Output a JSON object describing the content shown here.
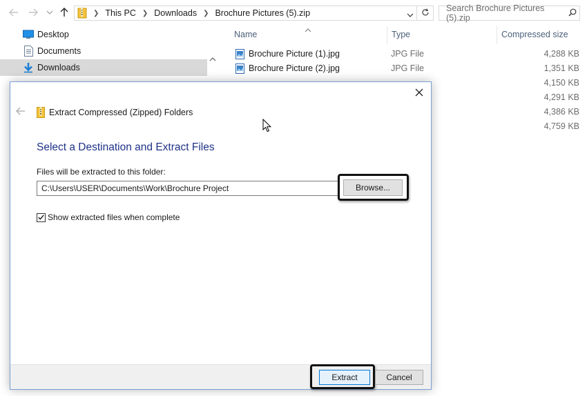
{
  "address_bar": {
    "crumbs": [
      "This PC",
      "Downloads",
      "Brochure Pictures (5).zip"
    ],
    "search_placeholder": "Search Brochure Pictures (5).zip"
  },
  "nav_pane": {
    "items": [
      {
        "label": "Desktop",
        "icon": "desktop-icon"
      },
      {
        "label": "Documents",
        "icon": "documents-icon"
      },
      {
        "label": "Downloads",
        "icon": "downloads-icon",
        "selected": true
      }
    ]
  },
  "file_list": {
    "columns": [
      "Name",
      "Type",
      "Compressed size"
    ],
    "files": [
      {
        "name": "Brochure Picture (1).jpg",
        "type": "JPG File",
        "size": "4,288 KB"
      },
      {
        "name": "Brochure Picture (2).jpg",
        "type": "JPG File",
        "size": "1,351 KB"
      },
      {
        "name": "",
        "type": "",
        "size": "4,150 KB"
      },
      {
        "name": "",
        "type": "",
        "size": "4,291 KB"
      },
      {
        "name": "",
        "type": "",
        "size": "4,386 KB"
      },
      {
        "name": "",
        "type": "",
        "size": "4,759 KB"
      }
    ]
  },
  "dialog": {
    "title": "Extract Compressed (Zipped) Folders",
    "heading": "Select a Destination and Extract Files",
    "folder_label": "Files will be extracted to this folder:",
    "path_value": "C:\\Users\\USER\\Documents\\Work\\Brochure Project",
    "browse_label": "Browse...",
    "show_files_label": "Show extracted files when complete",
    "show_files_checked": true,
    "extract_label": "Extract",
    "cancel_label": "Cancel"
  },
  "colors": {
    "heading_blue": "#1e3287",
    "accent_blue": "#0078d7",
    "selected_nav": "#d9d9d9"
  }
}
